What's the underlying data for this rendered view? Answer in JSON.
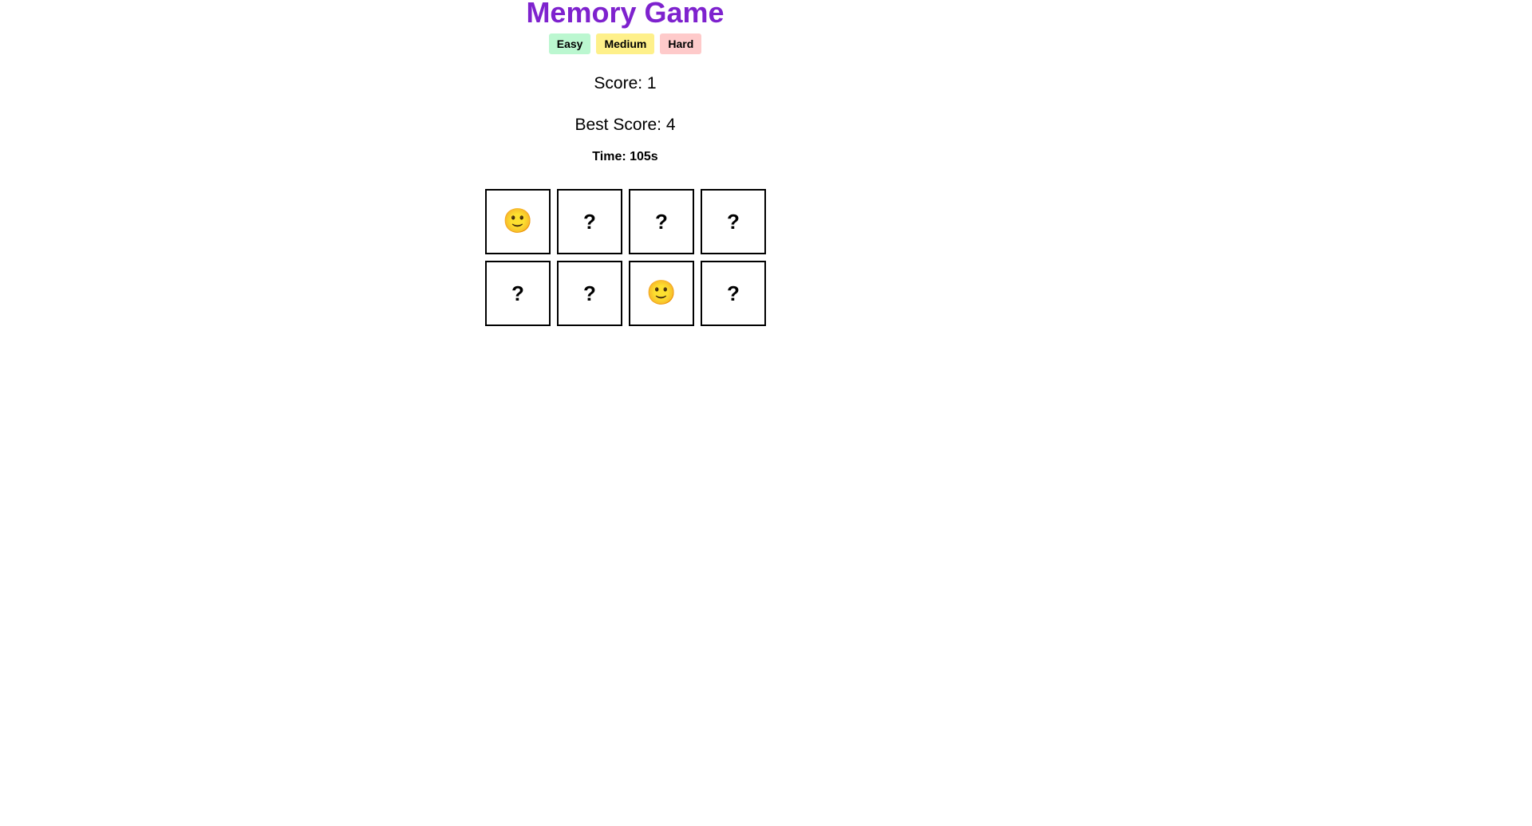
{
  "title": "Memory Game",
  "difficulty": {
    "buttons": [
      {
        "label": "Easy",
        "color": "#bbf7d0"
      },
      {
        "label": "Medium",
        "color": "#fef08a"
      },
      {
        "label": "Hard",
        "color": "#fecaca"
      }
    ]
  },
  "stats": {
    "score": "Score: 1",
    "best_score": "Best Score: 4",
    "time": "Time: 105s"
  },
  "colors": {
    "title": "#7e22ce",
    "card_border": "#000000"
  },
  "cards": [
    {
      "face": "🙂",
      "revealed": true
    },
    {
      "face": "?",
      "revealed": false
    },
    {
      "face": "?",
      "revealed": false
    },
    {
      "face": "?",
      "revealed": false
    },
    {
      "face": "?",
      "revealed": false
    },
    {
      "face": "?",
      "revealed": false
    },
    {
      "face": "🙂",
      "revealed": true
    },
    {
      "face": "?",
      "revealed": false
    }
  ]
}
